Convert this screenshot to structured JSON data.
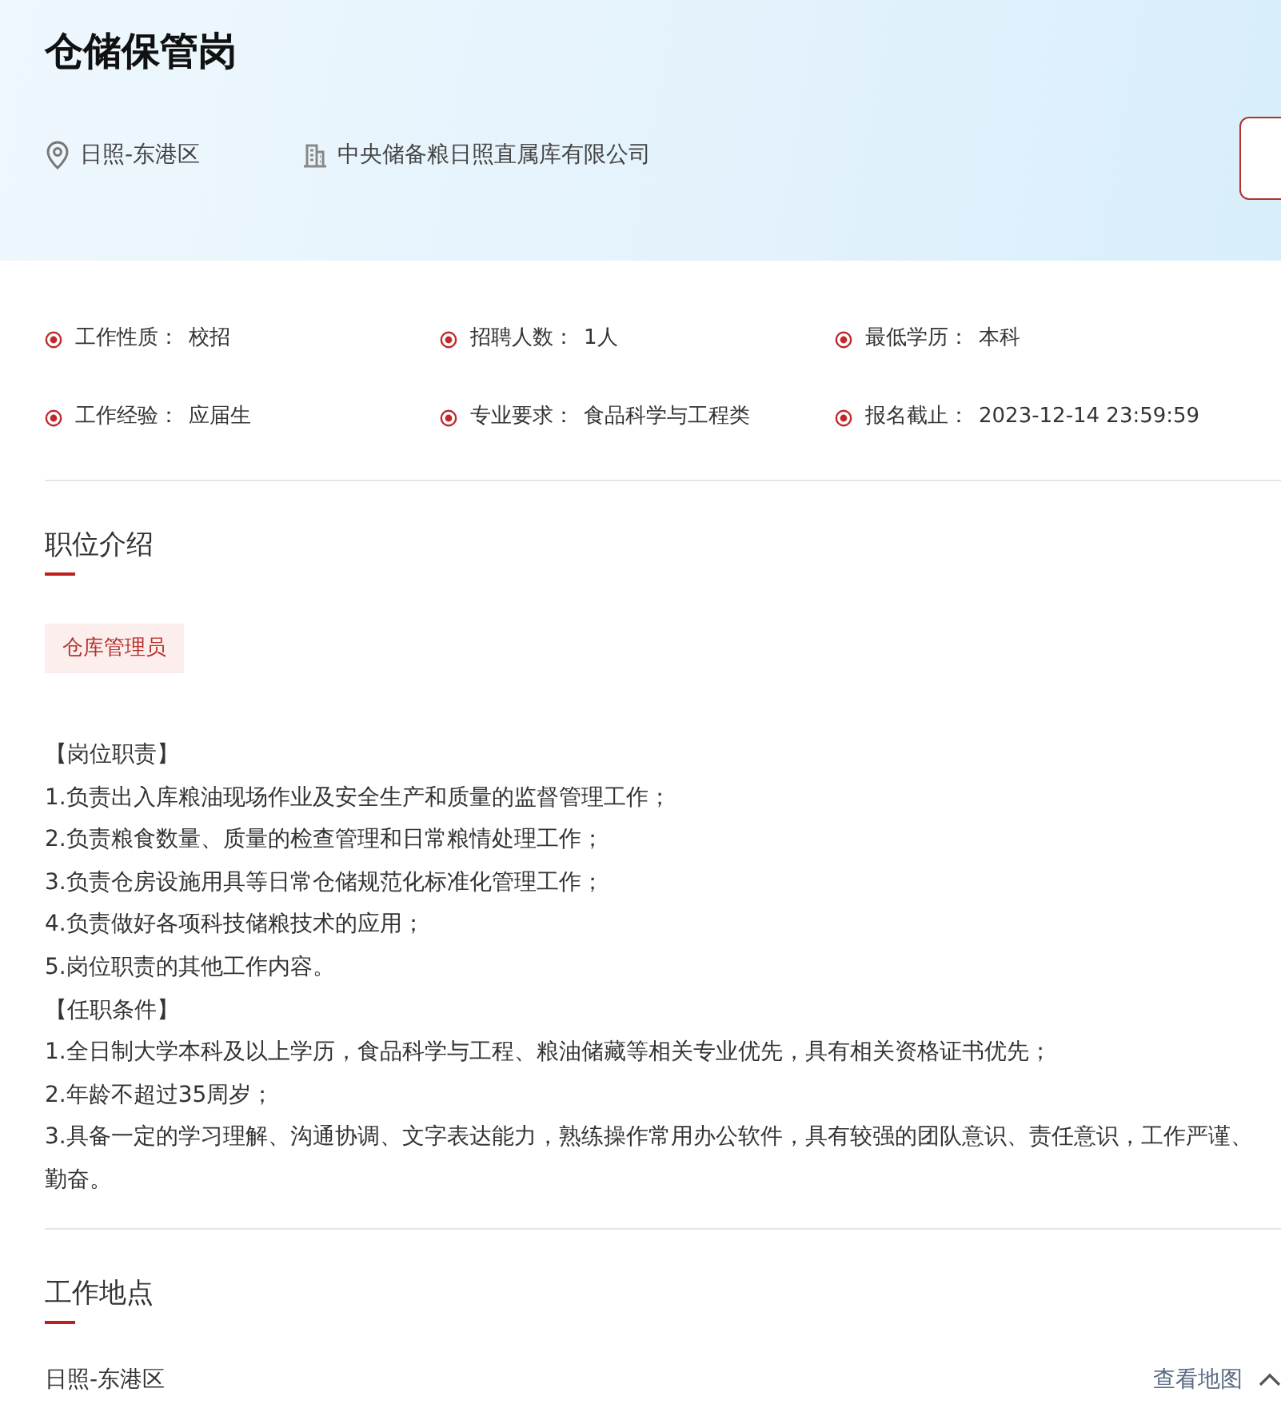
{
  "job": {
    "title": "仓储保管岗",
    "location": "日照-东港区",
    "company": "中央储备粮日照直属库有限公司"
  },
  "details": [
    {
      "label": "工作性质：",
      "value": "校招"
    },
    {
      "label": "招聘人数：",
      "value": "1人"
    },
    {
      "label": "最低学历：",
      "value": "本科"
    },
    {
      "label": "工作经验：",
      "value": "应届生"
    },
    {
      "label": "专业要求：",
      "value": "食品科学与工程类"
    },
    {
      "label": "报名截止：",
      "value": "2023-12-14 23:59:59"
    }
  ],
  "intro": {
    "heading": "职位介绍",
    "tags": [
      "仓库管理员"
    ],
    "lines": [
      "【岗位职责】",
      "1.负责出入库粮油现场作业及安全生产和质量的监督管理工作；",
      "2.负责粮食数量、质量的检查管理和日常粮情处理工作；",
      "3.负责仓房设施用具等日常仓储规范化标准化管理工作；",
      "4.负责做好各项科技储粮技术的应用；",
      "5.岗位职责的其他工作内容。",
      "【任职条件】",
      "1.全日制大学本科及以上学历，食品科学与工程、粮油储藏等相关专业优先，具有相关资格证书优先；",
      "2.年龄不超过35周岁；",
      "3.具备一定的学习理解、沟通协调、文字表达能力，熟练操作常用办公软件，具有较强的团队意识、责任意识，工作严谨、勤奋。"
    ]
  },
  "workplace": {
    "heading": "工作地点",
    "address": "日照-东港区",
    "map_link": "查看地图",
    "expanded": true
  }
}
